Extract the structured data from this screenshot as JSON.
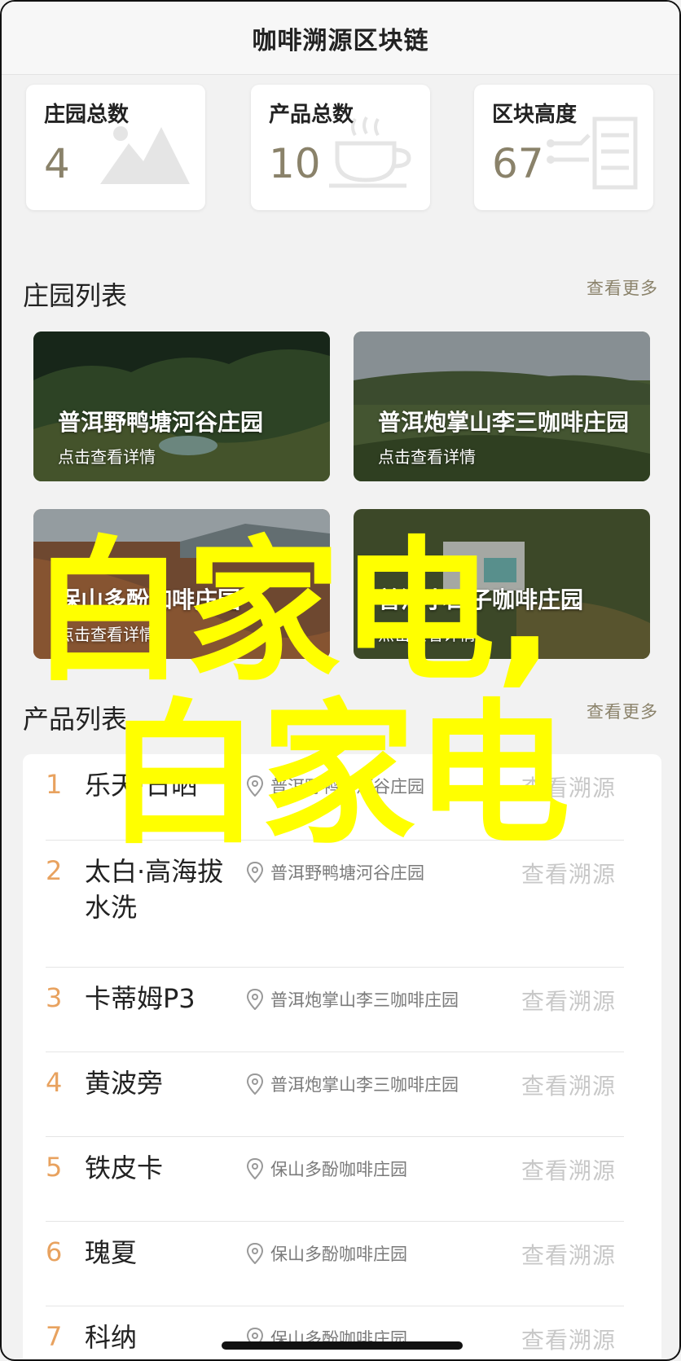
{
  "header": {
    "title": "咖啡溯源区块链"
  },
  "stats": [
    {
      "label": "庄园总数",
      "value": "4",
      "icon": "mountain-icon"
    },
    {
      "label": "产品总数",
      "value": "10",
      "icon": "coffee-cup-icon"
    },
    {
      "label": "区块高度",
      "value": "67",
      "icon": "server-icon"
    }
  ],
  "estates_section": {
    "title": "庄园列表",
    "more": "查看更多"
  },
  "estates": [
    {
      "name": "普洱野鸭塘河谷庄园",
      "sub": "点击查看详情"
    },
    {
      "name": "普洱炮掌山李三咖啡庄园",
      "sub": "点击查看详情"
    },
    {
      "name": "保山多酚咖啡庄园",
      "sub": "点击查看详情"
    },
    {
      "name": "普洱小凹子咖啡庄园",
      "sub": "点击查看详情"
    }
  ],
  "products_section": {
    "title": "产品列表",
    "more": "查看更多"
  },
  "products": [
    {
      "num": "1",
      "name": "乐天·日晒",
      "location": "普洱野鸭塘河谷庄园",
      "action": "查看溯源"
    },
    {
      "num": "2",
      "name": "太白·高海拔水洗",
      "location": "普洱野鸭塘河谷庄园",
      "action": "查看溯源"
    },
    {
      "num": "3",
      "name": "卡蒂姆P3",
      "location": "普洱炮掌山李三咖啡庄园",
      "action": "查看溯源"
    },
    {
      "num": "4",
      "name": "黄波旁",
      "location": "普洱炮掌山李三咖啡庄园",
      "action": "查看溯源"
    },
    {
      "num": "5",
      "name": "铁皮卡",
      "location": "保山多酚咖啡庄园",
      "action": "查看溯源"
    },
    {
      "num": "6",
      "name": "瑰夏",
      "location": "保山多酚咖啡庄园",
      "action": "查看溯源"
    },
    {
      "num": "7",
      "name": "科纳",
      "location": "保山多酚咖啡庄园",
      "action": "查看溯源"
    }
  ],
  "overlay": {
    "line1": "白家电,",
    "line2": "白家电"
  },
  "colors": {
    "accent_number": "#e8a25f",
    "stat_value": "#8a826a",
    "overlay": "#ffff00"
  }
}
